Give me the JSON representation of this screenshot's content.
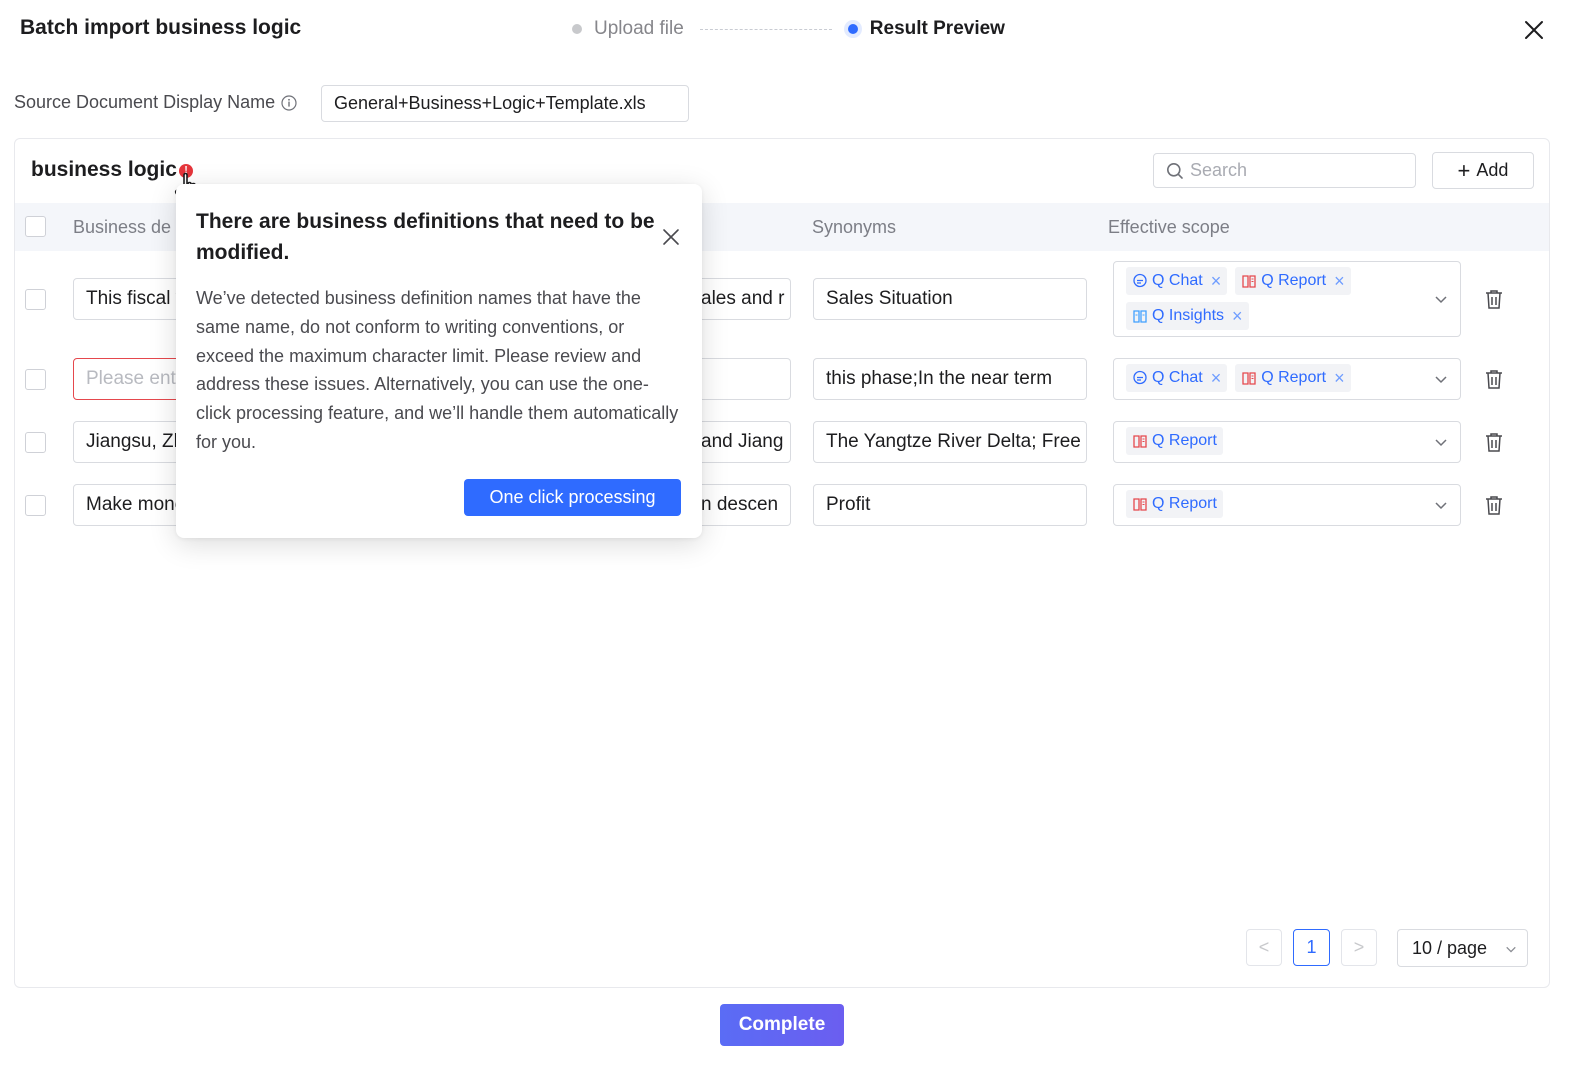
{
  "modal": {
    "title": "Batch import business logic",
    "steps": [
      {
        "label": "Upload file",
        "state": "inactive"
      },
      {
        "label": "Result Preview",
        "state": "active"
      }
    ]
  },
  "source": {
    "label": "Source Document Display Name",
    "value": "General+Business+Logic+Template.xls"
  },
  "panel": {
    "title": "business logic",
    "alert_glyph": "!",
    "search_placeholder": "Search",
    "add_label": "Add"
  },
  "table": {
    "headers": {
      "business_definition": "Business de",
      "synonyms": "Synonyms",
      "effective_scope": "Effective scope"
    },
    "rows": [
      {
        "name": "This fiscal y",
        "name_placeholder": "",
        "description": "ales and r",
        "synonyms": "Sales Situation",
        "scopes": [
          "Q Chat",
          "Q Report",
          "Q Insights"
        ]
      },
      {
        "name": "",
        "name_placeholder": "Please ente",
        "description": "",
        "synonyms": "this phase;In the near term",
        "scopes": [
          "Q Chat",
          "Q Report"
        ]
      },
      {
        "name": "Jiangsu, Zh",
        "name_placeholder": "",
        "description": "and Jiang",
        "synonyms": "The Yangtze River Delta; Free S",
        "scopes": [
          "Q Report"
        ]
      },
      {
        "name": "Make mone",
        "name_placeholder": "",
        "description": "n descen",
        "synonyms": "Profit",
        "scopes": [
          "Q Report"
        ]
      }
    ]
  },
  "pagination": {
    "prev": "<",
    "current": "1",
    "next": ">",
    "page_size": "10 / page"
  },
  "popover": {
    "title": "There are business definitions that need to be modified.",
    "body": "We’ve detected business definition names that have the same name, do not conform to writing conventions, or exceed the maximum character limit. Please review and address these issues. Alternatively, you can use the one-click processing feature, and we’ll handle them automatically for you.",
    "button": "One click processing"
  },
  "footer": {
    "complete_label": "Complete"
  },
  "colors": {
    "primary": "#2f6bff",
    "error": "#e5484d",
    "report_icon": "#e5484d",
    "chat_icon": "#2f6bff",
    "insights_icon": "#3fa0ff"
  },
  "icons": {
    "chat": "chat-bubble-icon",
    "report": "report-book-icon",
    "insights": "insights-book-icon",
    "trash": "trash-icon",
    "search": "search-icon",
    "close": "close-icon",
    "info": "info-circle-icon",
    "chevron": "chevron-down-icon",
    "cursor": "hand-pointer-icon"
  }
}
